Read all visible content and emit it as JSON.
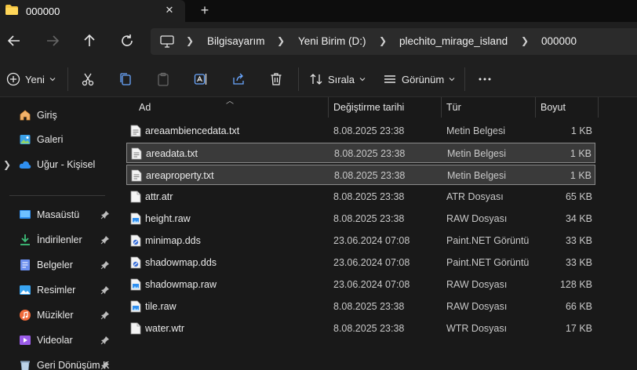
{
  "window": {
    "tab_title": "000000",
    "new_tab_symbol": "+"
  },
  "breadcrumb": [
    "Bilgisayarım",
    "Yeni Birim (D:)",
    "plechito_mirage_island",
    "000000"
  ],
  "toolbar": {
    "new_label": "Yeni",
    "sort_label": "Sırala",
    "view_label": "Görünüm"
  },
  "sidebar": {
    "items": [
      {
        "label": "Giriş",
        "icon": "home-icon"
      },
      {
        "label": "Galeri",
        "icon": "gallery-icon"
      },
      {
        "label": "Uğur - Kişisel",
        "icon": "cloud-icon"
      },
      {
        "label": "Masaüstü",
        "icon": "desktop-icon"
      },
      {
        "label": "İndirilenler",
        "icon": "download-icon"
      },
      {
        "label": "Belgeler",
        "icon": "documents-icon"
      },
      {
        "label": "Resimler",
        "icon": "pictures-icon"
      },
      {
        "label": "Müzikler",
        "icon": "music-icon"
      },
      {
        "label": "Videolar",
        "icon": "videos-icon"
      },
      {
        "label": "Geri Dönüşüm K",
        "icon": "recycle-bin-icon"
      }
    ]
  },
  "columns": {
    "name": "Ad",
    "date": "Değiştirme tarihi",
    "type": "Tür",
    "size": "Boyut"
  },
  "files": [
    {
      "name": "areaambiencedata.txt",
      "date": "8.08.2025 23:38",
      "type": "Metin Belgesi",
      "size": "1 KB",
      "icon": "text-file-icon",
      "selected": false
    },
    {
      "name": "areadata.txt",
      "date": "8.08.2025 23:38",
      "type": "Metin Belgesi",
      "size": "1 KB",
      "icon": "text-file-icon",
      "selected": true
    },
    {
      "name": "areaproperty.txt",
      "date": "8.08.2025 23:38",
      "type": "Metin Belgesi",
      "size": "1 KB",
      "icon": "text-file-icon",
      "selected": true
    },
    {
      "name": "attr.atr",
      "date": "8.08.2025 23:38",
      "type": "ATR Dosyası",
      "size": "65 KB",
      "icon": "blank-file-icon",
      "selected": false
    },
    {
      "name": "height.raw",
      "date": "8.08.2025 23:38",
      "type": "RAW Dosyası",
      "size": "34 KB",
      "icon": "image-file-icon",
      "selected": false
    },
    {
      "name": "minimap.dds",
      "date": "23.06.2024 07:08",
      "type": "Paint.NET Görüntü",
      "size": "33 KB",
      "icon": "paintnet-file-icon",
      "selected": false
    },
    {
      "name": "shadowmap.dds",
      "date": "23.06.2024 07:08",
      "type": "Paint.NET Görüntü",
      "size": "33 KB",
      "icon": "paintnet-file-icon",
      "selected": false
    },
    {
      "name": "shadowmap.raw",
      "date": "23.06.2024 07:08",
      "type": "RAW Dosyası",
      "size": "128 KB",
      "icon": "image-file-icon",
      "selected": false
    },
    {
      "name": "tile.raw",
      "date": "8.08.2025 23:38",
      "type": "RAW Dosyası",
      "size": "66 KB",
      "icon": "image-file-icon",
      "selected": false
    },
    {
      "name": "water.wtr",
      "date": "8.08.2025 23:38",
      "type": "WTR Dosyası",
      "size": "17 KB",
      "icon": "blank-file-icon",
      "selected": false
    }
  ]
}
